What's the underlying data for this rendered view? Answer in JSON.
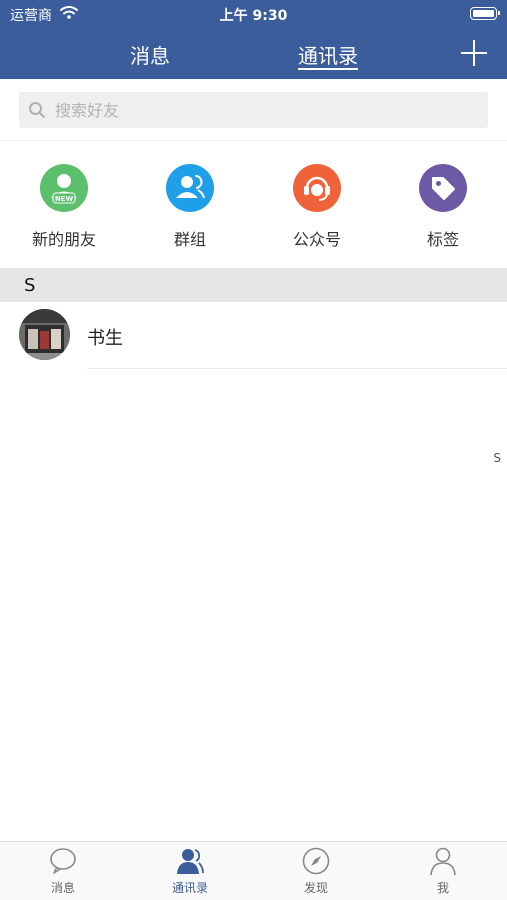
{
  "status": {
    "carrier": "运营商",
    "time": "上午 9:30"
  },
  "header": {
    "tab_messages": "消息",
    "tab_contacts": "通讯录",
    "active_tab": "通讯录"
  },
  "search": {
    "placeholder": "搜索好友"
  },
  "shortcuts": [
    {
      "label": "新的朋友",
      "icon": "new-friends-icon",
      "color": "#5bbf6c",
      "badge": "NEW"
    },
    {
      "label": "群组",
      "icon": "group-icon",
      "color": "#1e9fe8"
    },
    {
      "label": "公众号",
      "icon": "customer-service-icon",
      "color": "#f0623a"
    },
    {
      "label": "标签",
      "icon": "tag-icon",
      "color": "#6c5aa6"
    }
  ],
  "sections": [
    {
      "letter": "S",
      "contacts": [
        {
          "name": "书生"
        }
      ]
    }
  ],
  "index_bar": [
    "S"
  ],
  "tabbar": [
    {
      "label": "消息",
      "icon": "chat-bubble-icon"
    },
    {
      "label": "通讯录",
      "icon": "contacts-icon",
      "active": true
    },
    {
      "label": "发现",
      "icon": "compass-icon"
    },
    {
      "label": "我",
      "icon": "person-icon"
    }
  ],
  "colors": {
    "brand": "#3b5d9c",
    "section_bg": "#e6e6e6",
    "tab_inactive": "#666666"
  }
}
